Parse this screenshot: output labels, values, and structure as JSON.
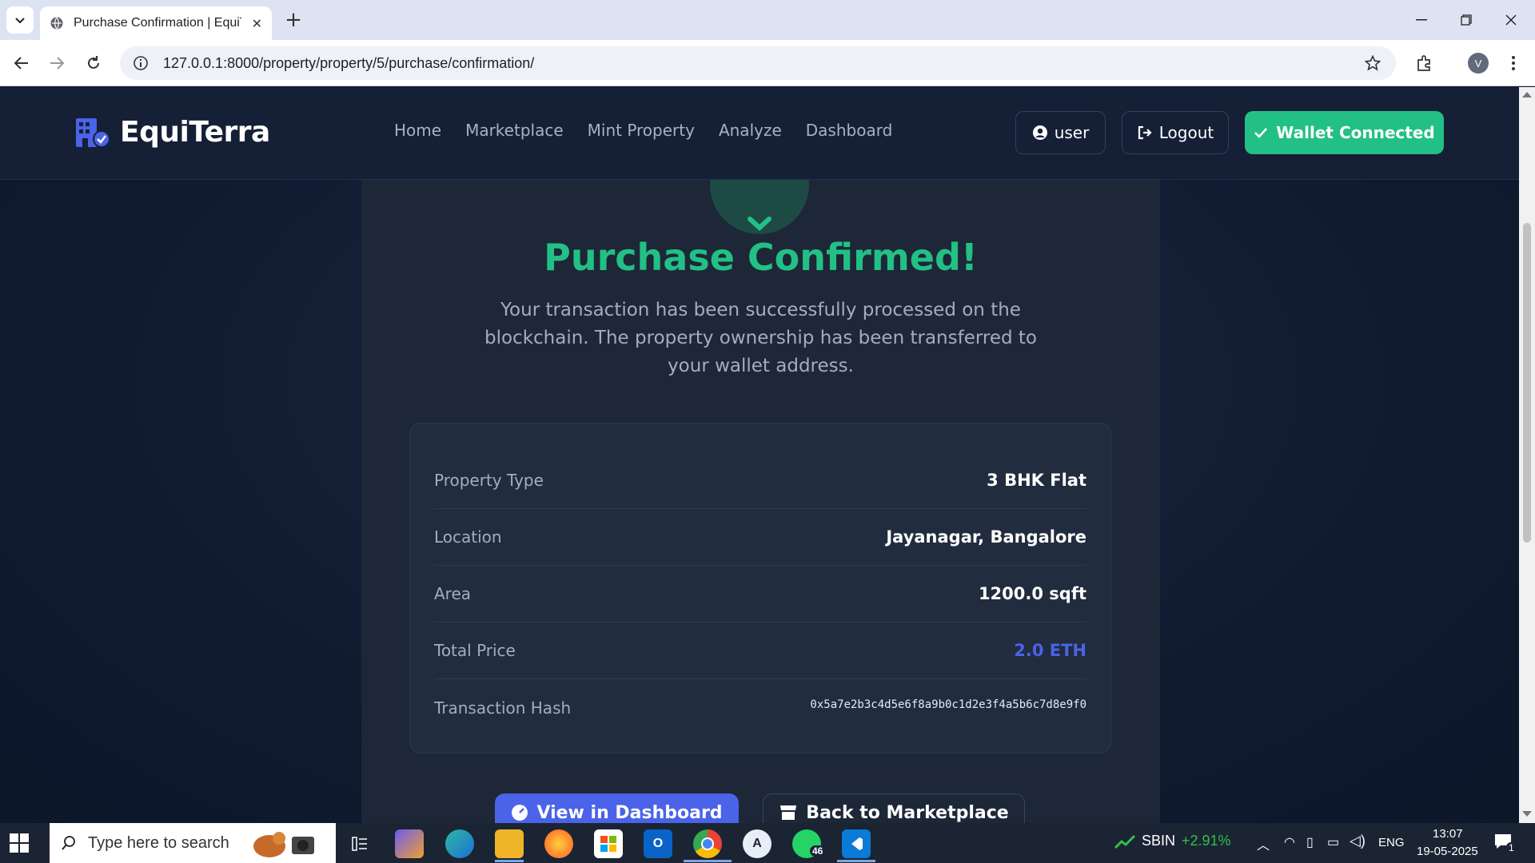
{
  "browser": {
    "tab_title": "Purchase Confirmation | EquiTerra",
    "url": "127.0.0.1:8000/property/property/5/purchase/confirmation/",
    "profile_initial": "V"
  },
  "nav": {
    "brand": "EquiTerra",
    "links": [
      "Home",
      "Marketplace",
      "Mint Property",
      "Analyze",
      "Dashboard"
    ],
    "user_label": "user",
    "logout_label": "Logout",
    "wallet_label": "Wallet Connected"
  },
  "confirmation": {
    "title": "Purchase Confirmed!",
    "message": "Your transaction has been successfully processed on the blockchain. The property ownership has been transferred to your wallet address."
  },
  "details": [
    {
      "label": "Property Type",
      "value": "3 BHK Flat"
    },
    {
      "label": "Location",
      "value": "Jayanagar, Bangalore"
    },
    {
      "label": "Area",
      "value": "1200.0 sqft"
    },
    {
      "label": "Total Price",
      "value": "2.0 ETH"
    },
    {
      "label": "Transaction Hash",
      "value": "0x5a7e2b3c4d5e6f8a9b0c1d2e3f4a5b6c7d8e9f0"
    }
  ],
  "actions": {
    "dashboard_label": "View in Dashboard",
    "marketplace_label": "Back to Marketplace"
  },
  "taskbar": {
    "search_placeholder": "Type here to search",
    "whatsapp_badge": "46",
    "stock_symbol": "SBIN",
    "stock_change": "+2.91%",
    "language": "ENG",
    "time": "13:07",
    "date": "19-05-2025",
    "notification_count": "1"
  },
  "colors": {
    "accent_green": "#22c084",
    "accent_blue": "#4a63e8",
    "page_bg": "#111b30",
    "panel_bg": "#1d2738"
  }
}
